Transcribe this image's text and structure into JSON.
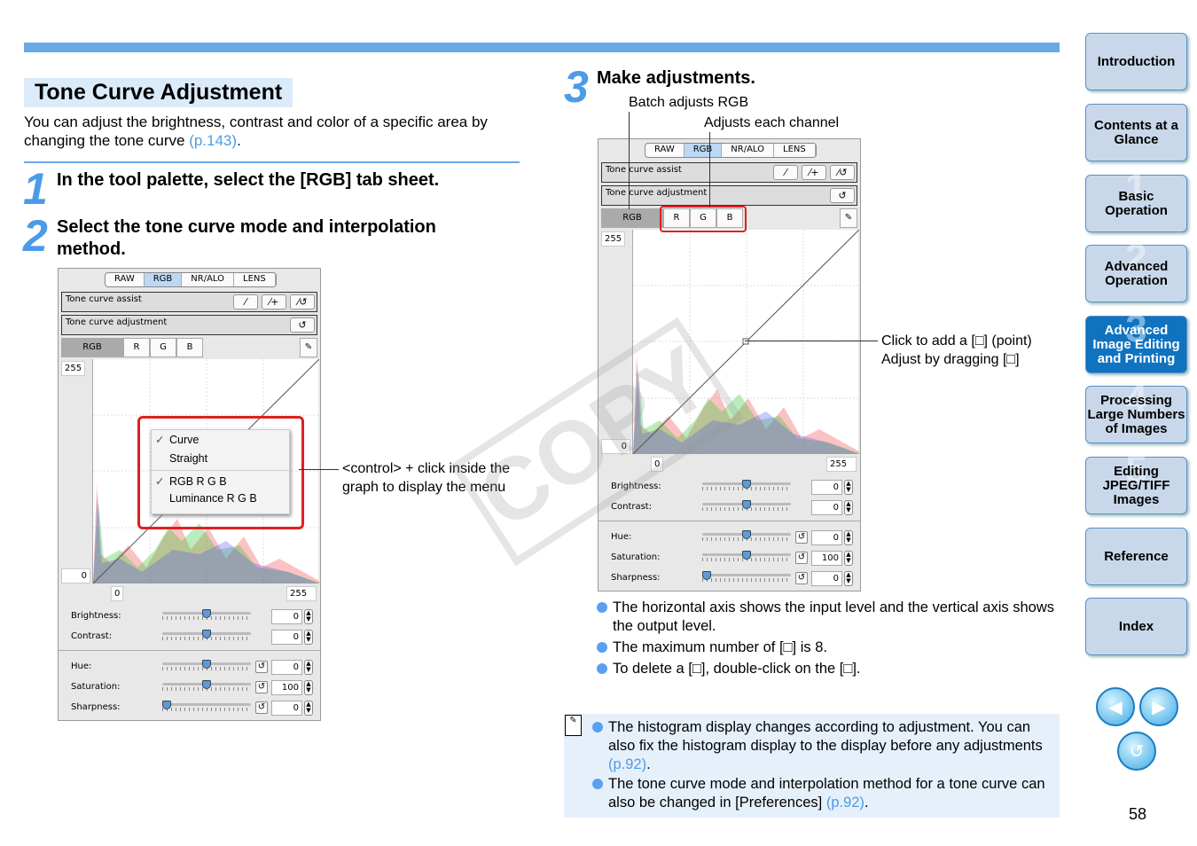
{
  "title": "Tone Curve Adjustment",
  "intro": {
    "text": "You can adjust the brightness, contrast and color of a specific area by changing the tone curve ",
    "link": "(p.143)",
    "end": "."
  },
  "steps": [
    {
      "num": "1",
      "text": "In the tool palette, select the [RGB] tab sheet."
    },
    {
      "num": "2",
      "text": "Select the tone curve mode and interpolation method."
    },
    {
      "num": "3",
      "text": "Make adjustments."
    }
  ],
  "panel": {
    "tabs": [
      "RAW",
      "RGB",
      "NR/ALO",
      "LENS"
    ],
    "assist_label": "Tone curve assist",
    "adjust_label": "Tone curve adjustment",
    "channels": [
      "RGB",
      "R",
      "G",
      "B"
    ],
    "y_max": "255",
    "y_min": "0",
    "x_min": "0",
    "x_max": "255",
    "sliders": [
      {
        "label": "Brightness:",
        "value": "0",
        "pos": 0.5
      },
      {
        "label": "Contrast:",
        "value": "0",
        "pos": 0.5
      },
      {
        "label": "Hue:",
        "value": "0",
        "pos": 0.5
      },
      {
        "label": "Saturation:",
        "value": "100",
        "pos": 0.5
      },
      {
        "label": "Sharpness:",
        "value": "0",
        "pos": 0.0
      }
    ]
  },
  "menu": {
    "items": [
      {
        "check": "✓",
        "label": "Curve"
      },
      {
        "check": "",
        "label": "Straight"
      },
      {
        "check": "✓",
        "label": "RGB R G B"
      },
      {
        "check": "",
        "label": "Luminance R G B"
      }
    ]
  },
  "callouts": {
    "menu": "<control> + click inside the graph to display the menu",
    "batch": "Batch adjusts RGB",
    "each": "Adjusts each channel",
    "point1": "Click to add a [□] (point)",
    "point2": "Adjust by dragging [□]"
  },
  "bullets": [
    "The horizontal axis shows the input level and the vertical axis shows the output level.",
    "The maximum number of [□] is 8.",
    "To delete a [□], double-click on the [□]."
  ],
  "notes": [
    {
      "text": "The histogram display changes according to adjustment. You can also fix the histogram display to the display before any adjustments ",
      "link": "(p.92)",
      "end": "."
    },
    {
      "text": "The tone curve mode and interpolation method for a tone curve can also be changed in [Preferences] ",
      "link": "(p.92)",
      "end": "."
    }
  ],
  "watermark": "COPY",
  "nav": [
    "Introduction",
    "Contents at a Glance",
    "Basic Operation",
    "Advanced Operation",
    "Advanced Image Editing and Printing",
    "Processing Large Numbers of Images",
    "Editing JPEG/TIFF Images",
    "Reference",
    "Index"
  ],
  "nav_active": 4,
  "nav_numbers": [
    "",
    "",
    "1",
    "2",
    "3",
    "4",
    "5",
    "",
    ""
  ],
  "page_number": "58",
  "colors": {
    "accent": "#6aa8e8",
    "link": "#4a9be8",
    "active_nav": "#0f73bf",
    "highlight": "#e02020"
  }
}
